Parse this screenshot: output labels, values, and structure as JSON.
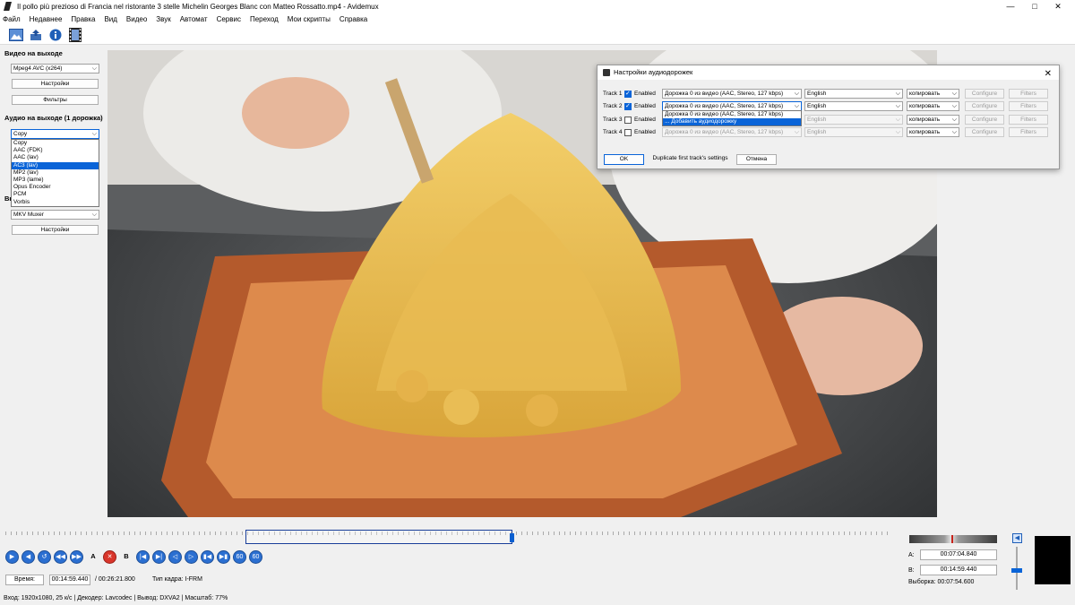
{
  "window": {
    "title": "Il pollo più prezioso di Francia nel ristorante 3 stelle Michelin Georges Blanc con Matteo Rossatto.mp4 - Avidemux",
    "minimize": "—",
    "maximize": "□",
    "close": "✕"
  },
  "menu": [
    "Файл",
    "Недавнее",
    "Правка",
    "Вид",
    "Видео",
    "Звук",
    "Автомат",
    "Сервис",
    "Переход",
    "Мои скрипты",
    "Справка"
  ],
  "left": {
    "video_out_label": "Видео на выходе",
    "video_codec": "Mpeg4 AVC (x264)",
    "settings_btn": "Настройки",
    "filters_btn": "Фильтры",
    "audio_out_label": "Аудио на выходе (1 дорожка)",
    "audio_codec": "Copy",
    "audio_options": [
      "Copy",
      "AAC (FDK)",
      "AAC (lav)",
      "AC3 (lav)",
      "MP2 (lav)",
      "MP3 (lame)",
      "Opus Encoder",
      "PCM",
      "Vorbis"
    ],
    "audio_selected_index": 3,
    "output_label_partial": "Вы",
    "muxer": "MKV Muxer",
    "muxer_settings_btn": "Настройки"
  },
  "dialog": {
    "title": "Настройки аудиодорожек",
    "enabled_label": "Enabled",
    "configure_label": "Configure",
    "filters_label": "Filters",
    "tracks": [
      {
        "label": "Track 1",
        "enabled": true,
        "source": "Дорожка 0 из видео (AAC, Stereo, 127 kbps)",
        "language": "English",
        "codec": "копировать"
      },
      {
        "label": "Track 2",
        "enabled": true,
        "source": "Дорожка 0 из видео (AAC, Stereo, 127 kbps)",
        "language": "English",
        "codec": "копировать"
      },
      {
        "label": "Track 3",
        "enabled": false,
        "source": "",
        "language": "English",
        "codec": "копировать"
      },
      {
        "label": "Track 4",
        "enabled": false,
        "source": "Дорожка 0 из видео (AAC, Stereo, 127 kbps)",
        "language": "English",
        "codec": "копировать"
      }
    ],
    "popup_options": [
      "Дорожка 0 из видео (AAC, Stereo, 127 kbps)",
      "... Добавить аудиодорожку"
    ],
    "ok_btn": "OK",
    "duplicate_btn": "Duplicate first track's settings",
    "cancel_btn": "Отмена"
  },
  "transport": {
    "controls": [
      "▶",
      "◀",
      "↺",
      "◀◀",
      "▶▶",
      "A",
      "✕",
      "B",
      "|◀",
      "▶|",
      "◁",
      "▷",
      "▮◀",
      "▶▮",
      "60",
      "60"
    ]
  },
  "time": {
    "time_label": "Время:",
    "current": "00:14:59.440",
    "total": "/ 00:26:21.800",
    "frame_type": "Тип кадра:  I-FRM"
  },
  "markers": {
    "a_label": "A:",
    "a_value": "00:07:04.840",
    "b_label": "B:",
    "b_value": "00:14:59.440",
    "selection": "Выборка: 00:07:54.600"
  },
  "status": "Вход: 1920x1080, 25 к/с  |  Декодер: Lavcodec  |  Вывод: DXVA2  |  Масштаб: 77%",
  "colors": {
    "accent": "#0a64d8",
    "frame_bg": "#f0f0f0"
  }
}
